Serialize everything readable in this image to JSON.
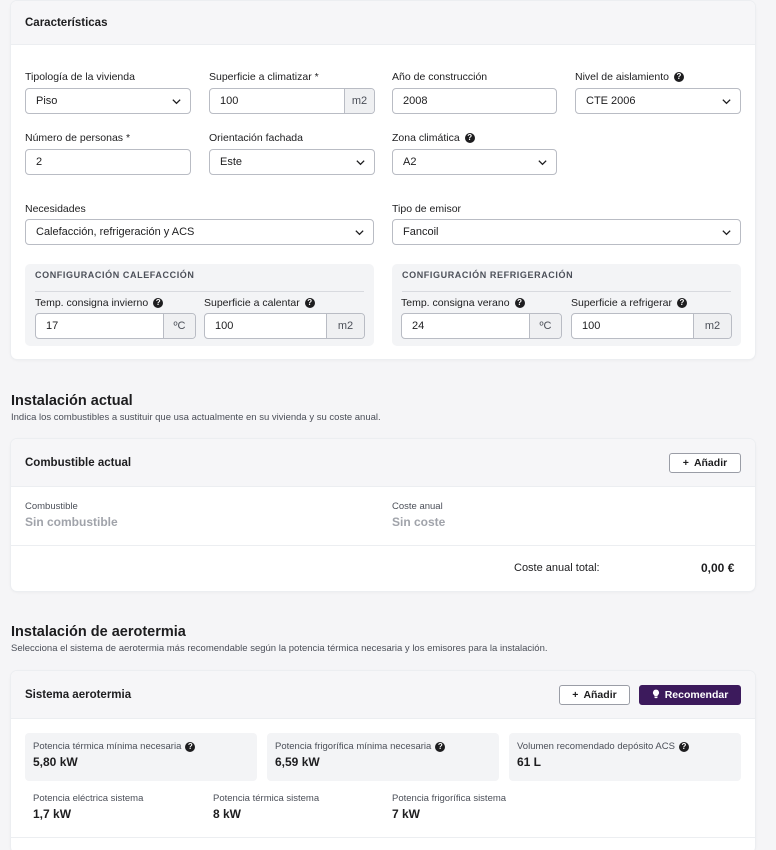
{
  "caracteristicas": {
    "title": "Características",
    "tipologia": {
      "label": "Tipología de la vivienda",
      "value": "Piso"
    },
    "superficie": {
      "label": "Superficie a climatizar *",
      "value": "100",
      "unit": "m2"
    },
    "anio": {
      "label": "Año de construcción",
      "value": "2008"
    },
    "aislamiento": {
      "label": "Nivel de aislamiento",
      "value": "CTE 2006"
    },
    "personas": {
      "label": "Número de personas *",
      "value": "2"
    },
    "orientacion": {
      "label": "Orientación fachada",
      "value": "Este"
    },
    "zona": {
      "label": "Zona climática",
      "value": "A2"
    },
    "necesidades": {
      "label": "Necesidades",
      "value": "Calefacción, refrigeración y ACS"
    },
    "emisor": {
      "label": "Tipo de emisor",
      "value": "Fancoil"
    },
    "calefaccion": {
      "title": "CONFIGURACIÓN CALEFACCIÓN",
      "temp": {
        "label": "Temp. consigna invierno",
        "value": "17",
        "unit": "ºC"
      },
      "sup": {
        "label": "Superficie a calentar",
        "value": "100",
        "unit": "m2"
      }
    },
    "refrigeracion": {
      "title": "CONFIGURACIÓN REFRIGERACIÓN",
      "temp": {
        "label": "Temp. consigna verano",
        "value": "24",
        "unit": "ºC"
      },
      "sup": {
        "label": "Superficie a refrigerar",
        "value": "100",
        "unit": "m2"
      }
    }
  },
  "instalacion_actual": {
    "title": "Instalación actual",
    "subtitle": "Indica los combustibles a sustituir que usa actualmente en su vivienda y su coste anual.",
    "card_title": "Combustible actual",
    "add_label": "Añadir",
    "combustible_label": "Combustible",
    "combustible_value": "Sin combustible",
    "coste_label": "Coste anual",
    "coste_value": "Sin coste",
    "total_label": "Coste anual total:",
    "total_value": "0,00 €"
  },
  "aerotermia": {
    "title": "Instalación de aerotermia",
    "subtitle": "Selecciona el sistema de aerotermia más recomendable según la potencia térmica necesaria y los emisores para la instalación.",
    "card_title": "Sistema aerotermia",
    "add_label": "Añadir",
    "recommend_label": "Recomendar",
    "stats": [
      {
        "label": "Potencia térmica mínima necesaria",
        "value": "5,80 kW"
      },
      {
        "label": "Potencia frigorífica mínima necesaria",
        "value": "6,59 kW"
      },
      {
        "label": "Volumen recomendado depósito ACS",
        "value": "61 L"
      }
    ],
    "sistema": [
      {
        "label": "Potencia eléctrica sistema",
        "value": "1,7 kW"
      },
      {
        "label": "Potencia térmica sistema",
        "value": "8 kW"
      },
      {
        "label": "Potencia frigorífica sistema",
        "value": "7 kW"
      }
    ]
  },
  "colors": {
    "accent": "#3c1a5c",
    "border": "#b9bcc4",
    "muted": "#a0a3aa"
  }
}
